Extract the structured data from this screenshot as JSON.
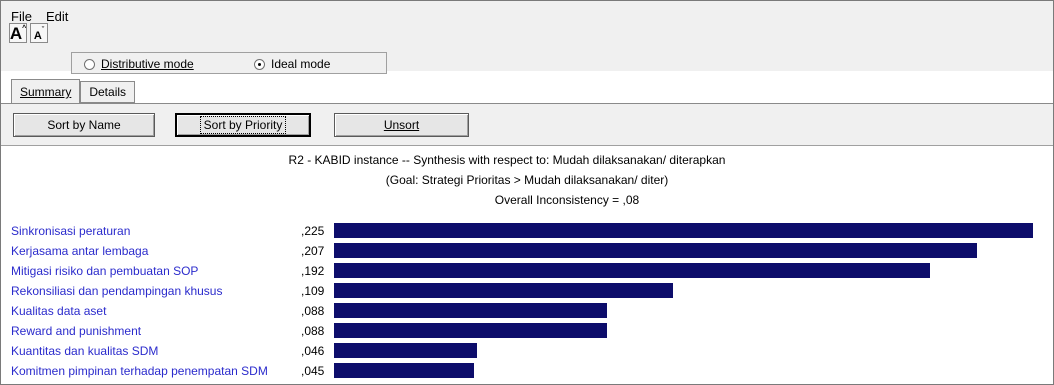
{
  "menu": {
    "file": "File",
    "edit": "Edit"
  },
  "font_buttons": {
    "increase": "A",
    "decrease": "A"
  },
  "mode": {
    "options": [
      {
        "label": "Distributive mode",
        "selected": false
      },
      {
        "label": "Ideal mode",
        "selected": true
      }
    ]
  },
  "tabs": [
    {
      "label": "Summary",
      "active": true
    },
    {
      "label": "Details",
      "active": false
    }
  ],
  "sort_buttons": {
    "by_name": "Sort by Name",
    "by_priority": "Sort by Priority",
    "unsort": "Unsort"
  },
  "header": {
    "line1": "R2 - KABID instance -- Synthesis with respect to: Mudah dilaksanakan/ diterapkan",
    "line2": "(Goal: Strategi Prioritas  > Mudah dilaksanakan/ diter)",
    "line3": "Overall Inconsistency = ,08"
  },
  "colors": {
    "bar": "#0d0d6b",
    "label": "#2b2bcc"
  },
  "chart_data": {
    "type": "bar",
    "orientation": "horizontal",
    "categories": [
      "Sinkronisasi peraturan",
      "Kerjasama antar lembaga",
      "Mitigasi risiko dan pembuatan SOP",
      "Rekonsiliasi dan pendampingan khusus",
      "Kualitas data aset",
      "Reward and punishment",
      "Kuantitas dan kualitas SDM",
      "Komitmen pimpinan terhadap penempatan SDM"
    ],
    "values": [
      0.225,
      0.207,
      0.192,
      0.109,
      0.088,
      0.088,
      0.046,
      0.045
    ],
    "value_labels": [
      ",225",
      ",207",
      ",192",
      ",109",
      ",088",
      ",088",
      ",046",
      ",045"
    ]
  }
}
